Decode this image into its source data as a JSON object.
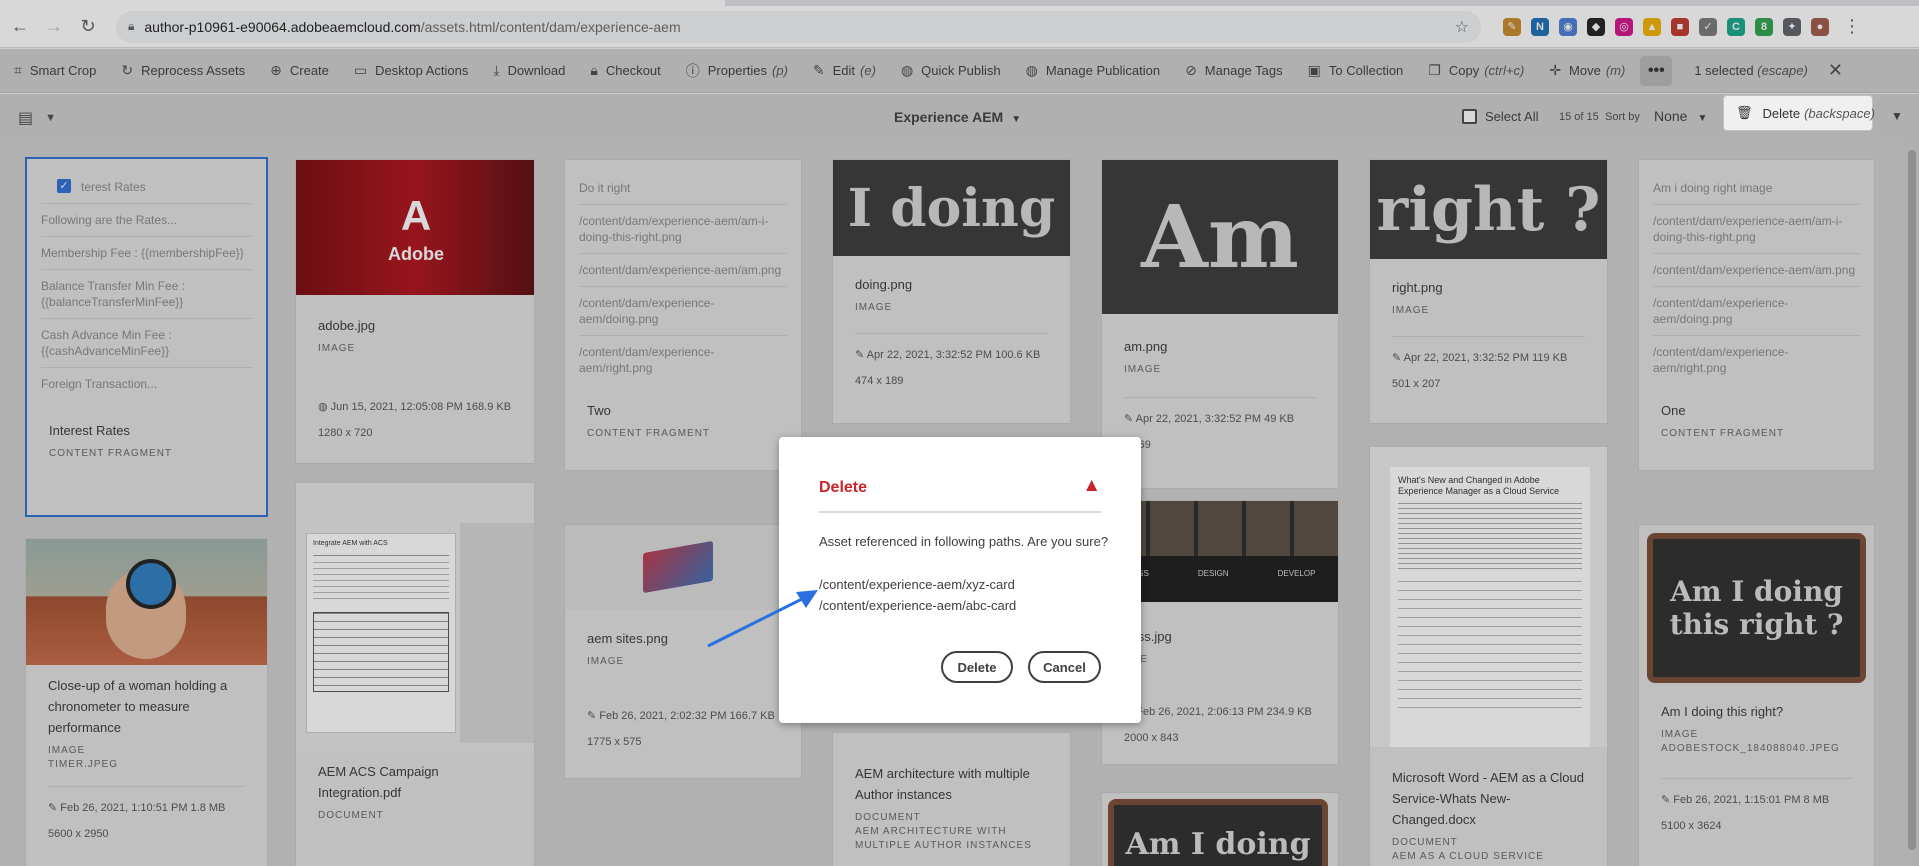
{
  "browser": {
    "url_host": "author-p10961-e90064.adobeaemcloud.com",
    "url_path": "/assets.html/content/dam/experience-aem",
    "extensions": [
      {
        "name": "pen-extension-icon",
        "color": "#c98a2a",
        "glyph": "✎"
      },
      {
        "name": "n-extension-icon",
        "color": "#1c6fb8",
        "glyph": "N"
      },
      {
        "name": "blue-circle-extension-icon",
        "color": "#4a7fd4",
        "glyph": "◉"
      },
      {
        "name": "dark-extension-icon",
        "color": "#222222",
        "glyph": "◆"
      },
      {
        "name": "pink-extension-icon",
        "color": "#d4148c",
        "glyph": "◎"
      },
      {
        "name": "drive-extension-icon",
        "color": "#f4b400",
        "glyph": "▲"
      },
      {
        "name": "red-extension-icon",
        "color": "#c0392b",
        "glyph": "■"
      },
      {
        "name": "check-extension-icon",
        "color": "#7a7a7a",
        "glyph": "✓"
      },
      {
        "name": "green-c-extension-icon",
        "color": "#17a889",
        "glyph": "C"
      },
      {
        "name": "green-badge-extension-icon",
        "color": "#2ea44f",
        "glyph": "8"
      },
      {
        "name": "puzzle-extension-icon",
        "color": "#5f6368",
        "glyph": "✦"
      },
      {
        "name": "avatar-extension-icon",
        "color": "#a05b4a",
        "glyph": "●"
      }
    ]
  },
  "actionbar": {
    "items": [
      {
        "label": "Smart Crop",
        "icon": "crop-icon",
        "glyph": "⌗",
        "kbd": ""
      },
      {
        "label": "Reprocess Assets",
        "icon": "refresh-icon",
        "glyph": "↻",
        "kbd": ""
      },
      {
        "label": "Create",
        "icon": "add-circle-icon",
        "glyph": "⊕",
        "kbd": ""
      },
      {
        "label": "Desktop Actions",
        "icon": "monitor-icon",
        "glyph": "▭",
        "kbd": ""
      },
      {
        "label": "Download",
        "icon": "download-icon",
        "glyph": "⤓",
        "kbd": ""
      },
      {
        "label": "Checkout",
        "icon": "lock-icon",
        "glyph": "🔒︎",
        "kbd": ""
      },
      {
        "label": "Properties",
        "icon": "info-icon",
        "glyph": "ⓘ",
        "kbd": "(p)"
      },
      {
        "label": "Edit",
        "icon": "pencil-icon",
        "glyph": "✎",
        "kbd": "(e)"
      },
      {
        "label": "Quick Publish",
        "icon": "globe-icon",
        "glyph": "◍",
        "kbd": ""
      },
      {
        "label": "Manage Publication",
        "icon": "globe-gear-icon",
        "glyph": "◍",
        "kbd": ""
      },
      {
        "label": "Manage Tags",
        "icon": "tag-icon",
        "glyph": "⊘",
        "kbd": ""
      },
      {
        "label": "To Collection",
        "icon": "collection-icon",
        "glyph": "▣",
        "kbd": ""
      },
      {
        "label": "Copy",
        "icon": "copy-icon",
        "glyph": "❐",
        "kbd": "(ctrl+c)"
      },
      {
        "label": "Move",
        "icon": "move-icon",
        "glyph": "✛",
        "kbd": "(m)"
      }
    ],
    "more": "•••",
    "selected_count": "1 selected",
    "escape_hint": "(escape)"
  },
  "popover": {
    "label": "Delete",
    "kbd": "(backspace)"
  },
  "subbar": {
    "folder": "Experience AEM",
    "select_all": "Select All",
    "count": "15 of 15",
    "sort_by": "Sort by",
    "sort_value": "None"
  },
  "cards": {
    "interest": {
      "rows": [
        "terest Rates",
        "Following are the Rates...",
        "Membership Fee : {{membershipFee}}",
        "Balance Transfer Min Fee : {{balanceTransferMinFee}}",
        "Cash Advance Min Fee : {{cashAdvanceMinFee}}",
        "Foreign Transaction..."
      ],
      "title": "Interest Rates",
      "type": "CONTENT FRAGMENT"
    },
    "adobe": {
      "logo_text": "Adobe",
      "title": "adobe.jpg",
      "type": "IMAGE",
      "meta": "Jun 15, 2021, 12:05:08 PM   168.9 KB",
      "dims": "1280 x 720"
    },
    "two": {
      "rows": [
        "Do it right",
        "/content/dam/experience-aem/am-i-doing-this-right.png",
        "/content/dam/experience-aem/am.png",
        "/content/dam/experience-aem/doing.png",
        "/content/dam/experience-aem/right.png"
      ],
      "title": "Two",
      "type": "CONTENT FRAGMENT"
    },
    "doing": {
      "word": "I doing",
      "title": "doing.png",
      "type": "IMAGE",
      "meta": "Apr 22, 2021, 3:32:52 PM   100.6 KB",
      "dims": "474 x 189"
    },
    "am": {
      "word": "Am",
      "title": "am.png",
      "type": "IMAGE",
      "meta": "Apr 22, 2021, 3:32:52 PM   49 KB",
      "dims": "x 169"
    },
    "right": {
      "word": "right ?",
      "title": "right.png",
      "type": "IMAGE",
      "meta": "Apr 22, 2021, 3:32:52 PM   119 KB",
      "dims": "501 x 207"
    },
    "one": {
      "rows": [
        "Am i doing right image",
        "/content/dam/experience-aem/am-i-doing-this-right.png",
        "/content/dam/experience-aem/am.png",
        "/content/dam/experience-aem/doing.png",
        "/content/dam/experience-aem/right.png"
      ],
      "title": "One",
      "type": "CONTENT FRAGMENT"
    },
    "timer": {
      "title": "Close-up of a woman holding a chronometer to measure performance",
      "type": "IMAGE",
      "sub": "TIMER.JPEG",
      "meta": "Feb 26, 2021, 1:10:51 PM   1.8 MB",
      "dims": "5600 x 2950"
    },
    "acs": {
      "doc_heading": "Integrate AEM with ACS",
      "title": "AEM ACS Campaign Integration.pdf",
      "type": "DOCUMENT"
    },
    "aemsites": {
      "title": "aem sites.png",
      "type": "IMAGE",
      "meta": "Feb 26, 2021, 2:02:32 PM   166.7 KB",
      "dims": "1775 x 575"
    },
    "arch": {
      "title": "AEM architecture with multiple Author instances",
      "type": "DOCUMENT",
      "sub": "AEM ARCHITECTURE WITH MULTIPLE AUTHOR INSTANCES"
    },
    "discuss": {
      "labels": [
        "CUSS",
        "DESIGN",
        "DEVELOP"
      ],
      "title": "cuss.jpg",
      "type": "AGE",
      "meta": "Feb 26, 2021, 2:06:13 PM   234.9 KB",
      "dims": "2000 x 843"
    },
    "word": {
      "doc_title": "What's New and Changed in Adobe Experience Manager as a Cloud Service",
      "title": "Microsoft Word - AEM as a Cloud Service-Whats New-Changed.docx",
      "type": "DOCUMENT",
      "sub": "AEM AS A CLOUD SERVICE WHATS"
    },
    "amidoing": {
      "word": "Am I doing this right ?",
      "title": "Am I doing this right?",
      "type": "IMAGE",
      "sub": "ADOBESTOCK_184088040.JPEG",
      "meta": "Feb 26, 2021, 1:15:01 PM   8 MB",
      "dims": "5100 x 3624"
    },
    "chalk2": {
      "word": "Am I doing"
    }
  },
  "dialog": {
    "title": "Delete",
    "message": "Asset referenced in following paths. Are you sure?",
    "paths": [
      "/content/experience-aem/xyz-card",
      "/content/experience-aem/abc-card"
    ],
    "delete_label": "Delete",
    "cancel_label": "Cancel"
  }
}
